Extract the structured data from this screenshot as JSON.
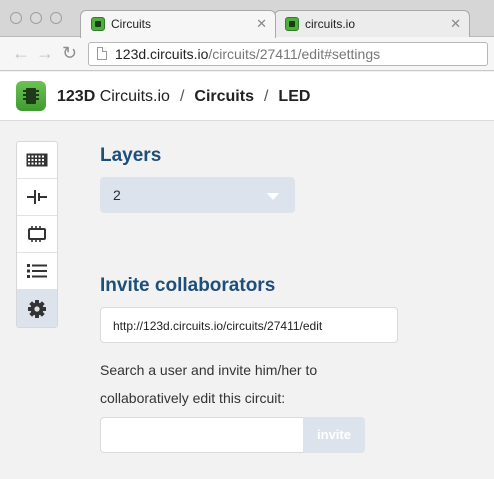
{
  "browser": {
    "tabs": [
      {
        "title": "Circuits",
        "active": true
      },
      {
        "title": "circuits.io",
        "active": false
      }
    ],
    "url_host": "123d.circuits.io",
    "url_path": "/circuits/27411/edit#settings"
  },
  "header": {
    "brand_bold": "123D",
    "brand_rest": " Circuits.io",
    "separator": "/",
    "crumbs": [
      "Circuits",
      "LED"
    ]
  },
  "rail": {
    "items": [
      {
        "icon": "breadboard-icon",
        "active": false
      },
      {
        "icon": "schematic-icon",
        "active": false
      },
      {
        "icon": "pcb-icon",
        "active": false
      },
      {
        "icon": "list-icon",
        "active": false
      },
      {
        "icon": "gear-icon",
        "active": true
      }
    ]
  },
  "settings": {
    "layers_title": "Layers",
    "layers_value": "2",
    "invite_title": "Invite collaborators",
    "share_url": "http://123d.circuits.io/circuits/27411/edit",
    "invite_desc": "Search a user and invite him/her to collaboratively edit this circuit:",
    "invite_placeholder": "",
    "invite_button": "invite"
  },
  "colors": {
    "accent_title": "#1d4f7a",
    "control_bg": "#dde3ec",
    "logo_green": "#4fae3e"
  }
}
